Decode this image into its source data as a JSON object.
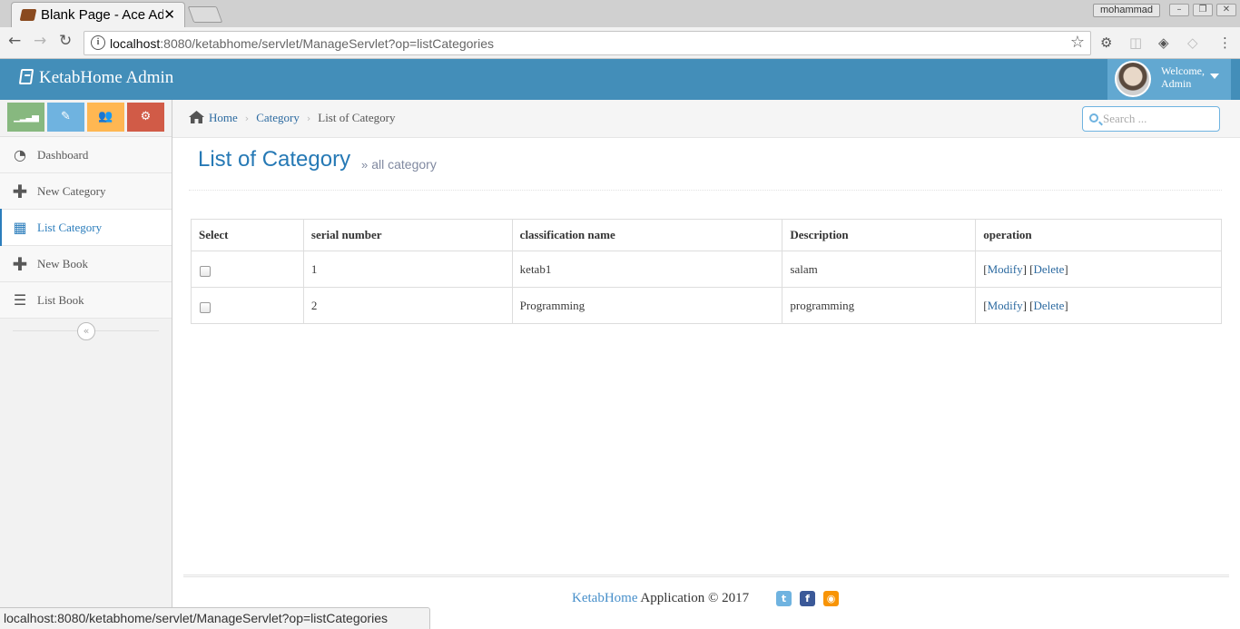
{
  "browser": {
    "tab_title": "Blank Page - Ace Admin",
    "tab_close": "✕",
    "profile_name": "mohammad",
    "window_minimize": "–",
    "window_restore": "❐",
    "window_close": "✕",
    "url_host": "localhost",
    "url_rest": ":8080/ketabhome/servlet/ManageServlet?op=listCategories",
    "status_url": "localhost:8080/ketabhome/servlet/ManageServlet?op=listCategories"
  },
  "navbar": {
    "brand": "KetabHome Admin",
    "welcome": "Welcome,",
    "user_name": "Admin"
  },
  "colors": {
    "navbar_bg": "#438eb9",
    "user_bg": "#62a8d1",
    "shortcut_success": "#87b87f",
    "shortcut_info": "#6fb3e0",
    "shortcut_warning": "#ffb752",
    "shortcut_danger": "#d15b47",
    "link_blue": "#2c6aa0",
    "title_blue": "#2679b5"
  },
  "sidebar": {
    "shortcuts": [
      {
        "name": "signal-icon"
      },
      {
        "name": "pencil-icon"
      },
      {
        "name": "users-icon"
      },
      {
        "name": "cogs-icon"
      }
    ],
    "items": [
      {
        "label": "Dashboard",
        "icon": "tachometer-icon"
      },
      {
        "label": "New Category",
        "icon": "plus-icon"
      },
      {
        "label": "List Category",
        "icon": "table-icon",
        "active": true
      },
      {
        "label": "New Book",
        "icon": "plus-icon"
      },
      {
        "label": "List Book",
        "icon": "list-icon"
      }
    ],
    "collapse_glyph": "«"
  },
  "breadcrumbs": {
    "home": "Home",
    "category": "Category",
    "current": "List of Category"
  },
  "search": {
    "placeholder": "Search ..."
  },
  "page": {
    "title": "List of Category",
    "subtitle_marker": "»",
    "subtitle": "all category"
  },
  "table": {
    "headers": [
      "Select",
      "serial number",
      "classification name",
      "Description",
      "operation"
    ],
    "rows": [
      {
        "serial": "1",
        "name": "ketab1",
        "description": "salam",
        "modify": "Modify",
        "delete": "Delete"
      },
      {
        "serial": "2",
        "name": "Programming",
        "description": "programming",
        "modify": "Modify",
        "delete": "Delete"
      }
    ]
  },
  "footer": {
    "brand": "KetabHome",
    "text": "Application © 2017"
  }
}
